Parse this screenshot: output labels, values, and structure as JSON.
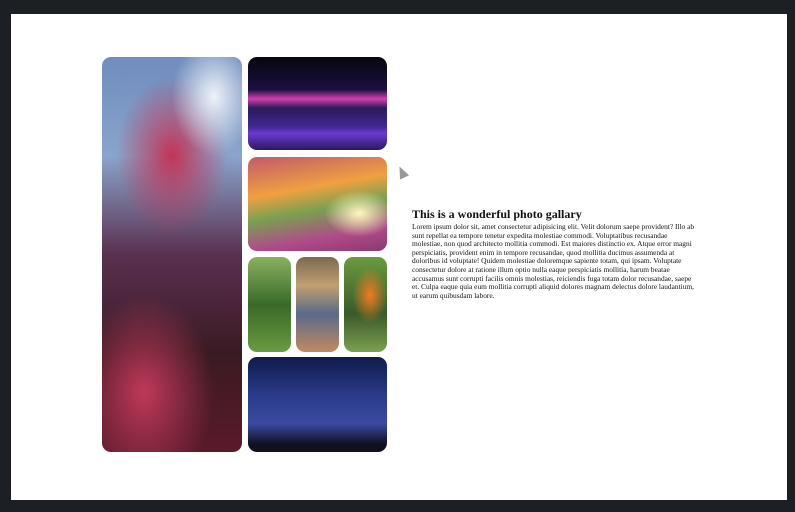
{
  "gallery": {
    "images": [
      {
        "name": "pink-flowers-sky"
      },
      {
        "name": "neon-mountains"
      },
      {
        "name": "sunset-flower-hill"
      },
      {
        "name": "green-tree"
      },
      {
        "name": "colorful-pebbles"
      },
      {
        "name": "bird-of-paradise"
      },
      {
        "name": "milky-way-tree"
      }
    ]
  },
  "article": {
    "title": "This is a wonderful photo gallary",
    "body": "Lorem ipsum dolor sit, amet consectetur adipisicing elit. Velit dolorum saepe provident? Illo ab sunt repellat ea tempore tenetur expedita molestiae commodi. Voluptatibus recusandae molestiae, non quod architecto mollitia commodi. Est maiores distinctio ex. Atque error magni perspiciatis, provident enim in tempore recusandae, quod mollitia ducimus assumenda at doloribus id voluptate! Quidem molestiae doloremque sapiente totam, qui ipsam. Voluptate consectetur dolore at ratione illum optio nulla eaque perspiciatis mollitia, harum beatae accusamus sunt corrupti facilis omnis molestias, reiciendis fuga totam dolor recusandae, saepe et. Culpa eaque quia eum mollitia corrupti aliquid dolores magnam delectus dolore laudantium, ut earum quibusdam labore."
  }
}
